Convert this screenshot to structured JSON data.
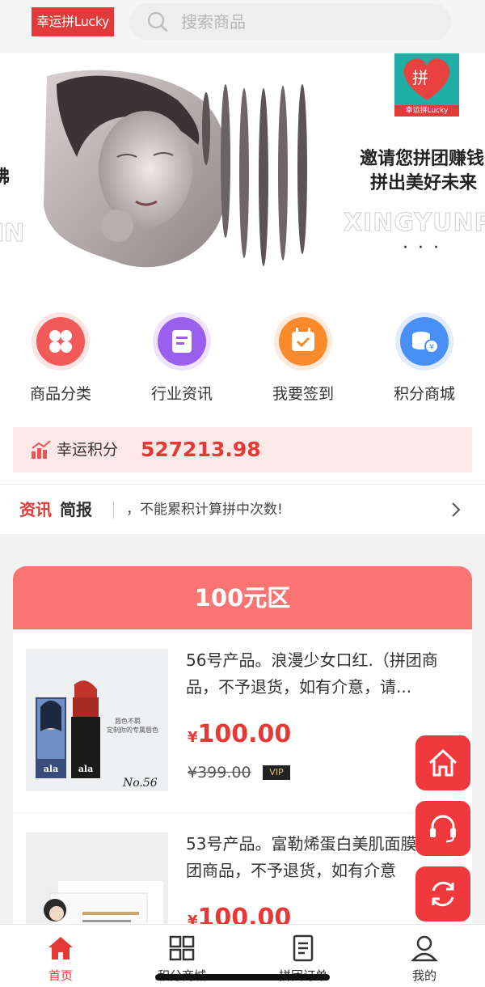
{
  "header": {
    "logo_text": "幸运拼Lucky",
    "search_placeholder": "搜索商品"
  },
  "banner": {
    "brand_tile_char": "拼",
    "brand_tile_caption": "幸运拼Lucky",
    "slogan_line1": "邀请您拼团赚钱",
    "slogan_line2": "拼出美好未来",
    "watermark_right": "XINGYUNP",
    "watermark_left": "IN",
    "left_partial_char": "拂",
    "dots": "···"
  },
  "quick_nav": [
    {
      "label": "商品分类",
      "icon": "clover-icon",
      "color": "#f25a5a"
    },
    {
      "label": "行业资讯",
      "icon": "document-icon",
      "color": "#9b5ff0"
    },
    {
      "label": "我要签到",
      "icon": "calendar-check-icon",
      "color": "#fb8a2d"
    },
    {
      "label": "积分商城",
      "icon": "coins-icon",
      "color": "#4a8ff5"
    }
  ],
  "points": {
    "label": "幸运积分",
    "value": "527213.98"
  },
  "news": {
    "title_red": "资讯",
    "title_dark": "简报",
    "message": "，不能累积计算拼中次数!"
  },
  "zone": {
    "title": "100元区",
    "products": [
      {
        "name": "56号产品。浪漫少女口红.（拼团商品，不予退货，如有介意，请...",
        "currency": "¥",
        "price": "100.00",
        "original_price": "¥399.00",
        "badge": "VIP",
        "thumb_caption": "No.56",
        "thumb_text1": "唇色不羁",
        "thumb_text2": "定制你的专属唇色",
        "thumb_brand": "ala"
      },
      {
        "name": "53号产品。富勒烯蛋白美肌面膜（拼团商品，不予退货，如有介意",
        "currency": "¥",
        "price": "100.00"
      }
    ]
  },
  "tabs": [
    {
      "label": "首页",
      "icon": "home-icon",
      "active": true
    },
    {
      "label": "积分商城",
      "icon": "grid-icon",
      "active": false
    },
    {
      "label": "拼团订单",
      "icon": "order-list-icon",
      "active": false
    },
    {
      "label": "我的",
      "icon": "user-icon",
      "active": false
    }
  ],
  "colors": {
    "brand_red": "#e53935",
    "zone_head": "#fb7474",
    "points_bg": "#fde8e8"
  }
}
